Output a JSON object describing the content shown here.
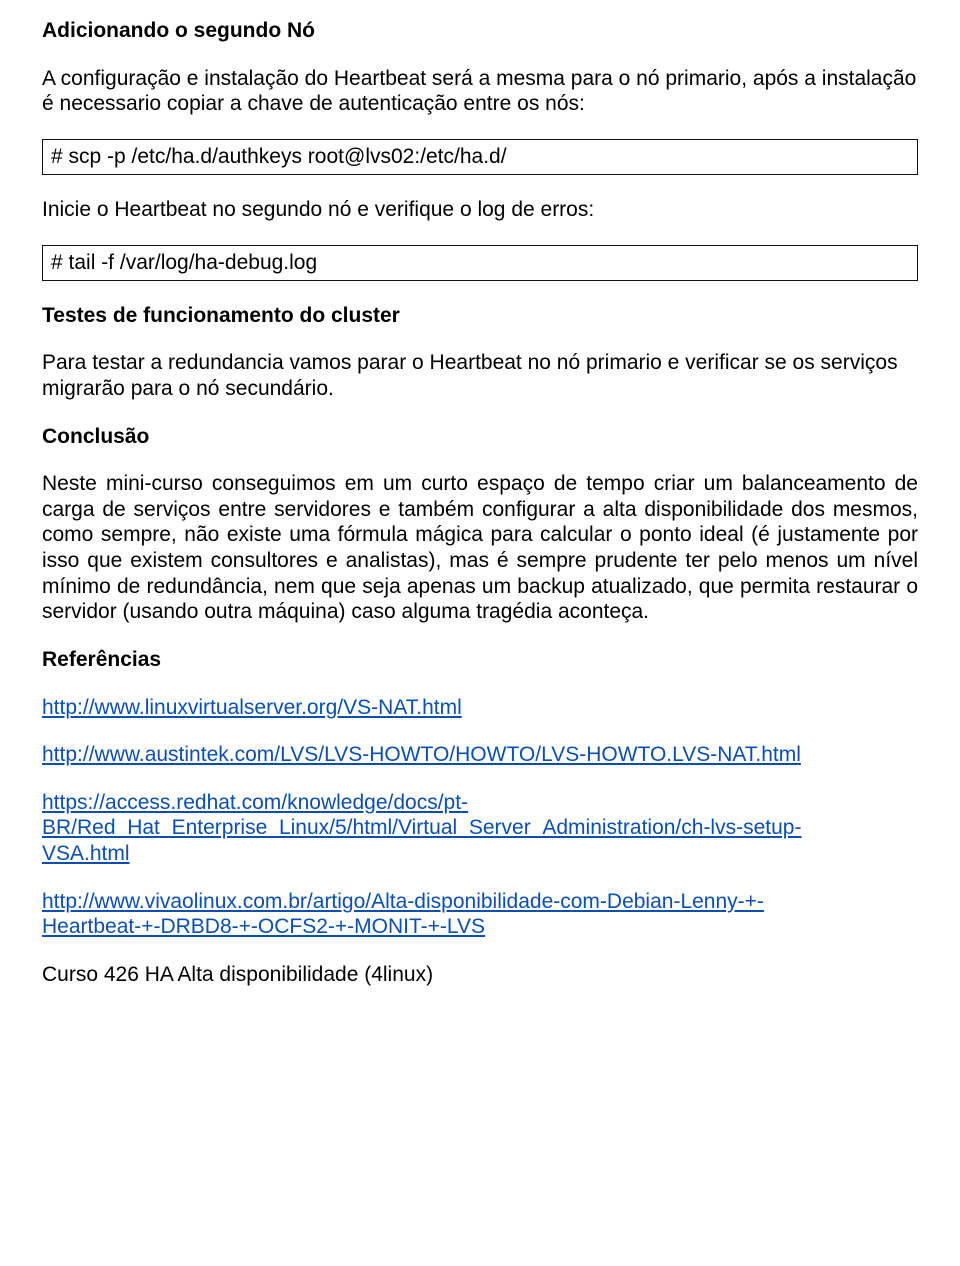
{
  "heading1": "Adicionando o segundo Nó",
  "para1": "A configuração e instalação do Heartbeat será a mesma para o nó primario, após a instalação é necessario copiar a chave de autenticação entre os nós:",
  "code1": "# scp -p /etc/ha.d/authkeys root@lvs02:/etc/ha.d/",
  "para2": "Inicie o Heartbeat no segundo nó e verifique o log de erros:",
  "code2": "# tail -f /var/log/ha-debug.log",
  "heading2": "Testes de funcionamento do cluster",
  "para3": "Para testar a redundancia vamos parar o Heartbeat no nó primario e verificar se os serviços migrarão para o nó secundário.",
  "heading3": "Conclusão",
  "para4": "Neste mini-curso conseguimos em um curto espaço de tempo criar um balanceamento de carga de serviços entre servidores e também configurar a alta disponibilidade dos mesmos, como sempre, não existe uma fórmula mágica para calcular o ponto ideal (é justamente por isso que existem consultores e analistas), mas é sempre prudente ter pelo menos um nível mínimo de redundância, nem que seja apenas um backup atualizado, que permita restaurar o servidor (usando outra máquina) caso alguma tragédia aconteça.",
  "heading4": "Referências",
  "ref1": "http://www.linuxvirtualserver.org/VS-NAT.html",
  "ref2": "http://www.austintek.com/LVS/LVS-HOWTO/HOWTO/LVS-HOWTO.LVS-NAT.html",
  "ref3a": "https://access.redhat.com/knowledge/docs/pt-",
  "ref3b": "BR/Red_Hat_Enterprise_Linux/5/html/Virtual_Server_Administration/ch-lvs-setup-",
  "ref3c": "VSA.html",
  "ref4a": "http://www.vivaolinux.com.br/artigo/Alta-disponibilidade-com-Debian-Lenny-+-",
  "ref4b": "Heartbeat-+-DRBD8-+-OCFS2-+-MONIT-+-LVS",
  "final": "Curso 426 HA Alta disponibilidade (4linux)"
}
